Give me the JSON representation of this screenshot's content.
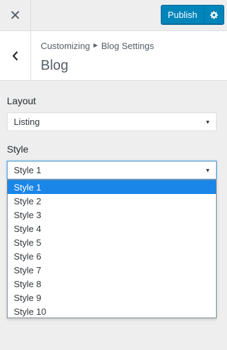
{
  "topbar": {
    "close_icon": "close-icon",
    "publish_label": "Publish",
    "settings_icon": "gear-icon",
    "accent_color": "#0085ba"
  },
  "section": {
    "breadcrumb_parent": "Customizing",
    "breadcrumb_separator_icon": "triangle-right-icon",
    "breadcrumb_current": "Blog Settings",
    "title": "Blog",
    "back_icon": "chevron-left-icon"
  },
  "controls": {
    "layout": {
      "label": "Layout",
      "value": "Listing"
    },
    "style": {
      "label": "Style",
      "value": "Style 1",
      "options": [
        "Style 1",
        "Style 2",
        "Style 3",
        "Style 4",
        "Style 5",
        "Style 6",
        "Style 7",
        "Style 8",
        "Style 9",
        "Style 10"
      ],
      "highlighted": "Style 1"
    }
  }
}
